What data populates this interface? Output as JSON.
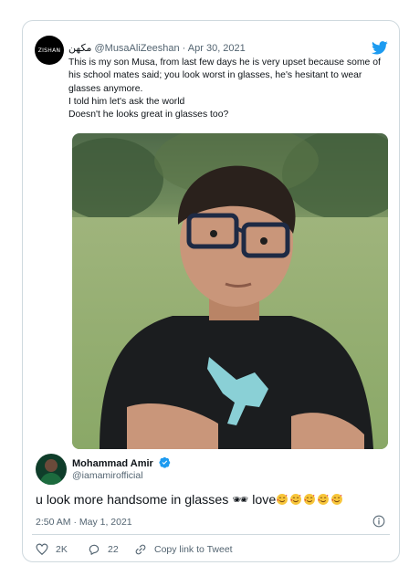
{
  "quoted_tweet": {
    "avatar_text": "ZISHAN",
    "display_name": "مکھن",
    "handle": "@MusaAliZeeshan",
    "separator": "·",
    "date": "Apr 30, 2021",
    "text_lines": [
      "This is my son Musa, from last few days he is very upset because some of his school mates said; you look worst in glasses, he's hesitant to wear glasses anymore.",
      "I told him let's ask the world",
      "Doesn't he looks great in glasses too?"
    ]
  },
  "tweet": {
    "display_name": "Mohammad Amir",
    "handle": "@iamamirofficial",
    "text": "u look more handsome in glasses 🕶 love",
    "timestamp": "2:50 AM · May 1, 2021",
    "likes": "2K",
    "replies": "22",
    "copy_link_label": "Copy link to Tweet"
  },
  "colors": {
    "twitter_blue": "#1d9bf0",
    "secondary_text": "#536471",
    "border": "#cfd9de"
  },
  "icons": [
    "twitter-bird-icon",
    "verified-badge-icon",
    "info-icon",
    "heart-icon",
    "reply-icon",
    "link-icon",
    "smiling-face-with-hearts-emoji"
  ]
}
